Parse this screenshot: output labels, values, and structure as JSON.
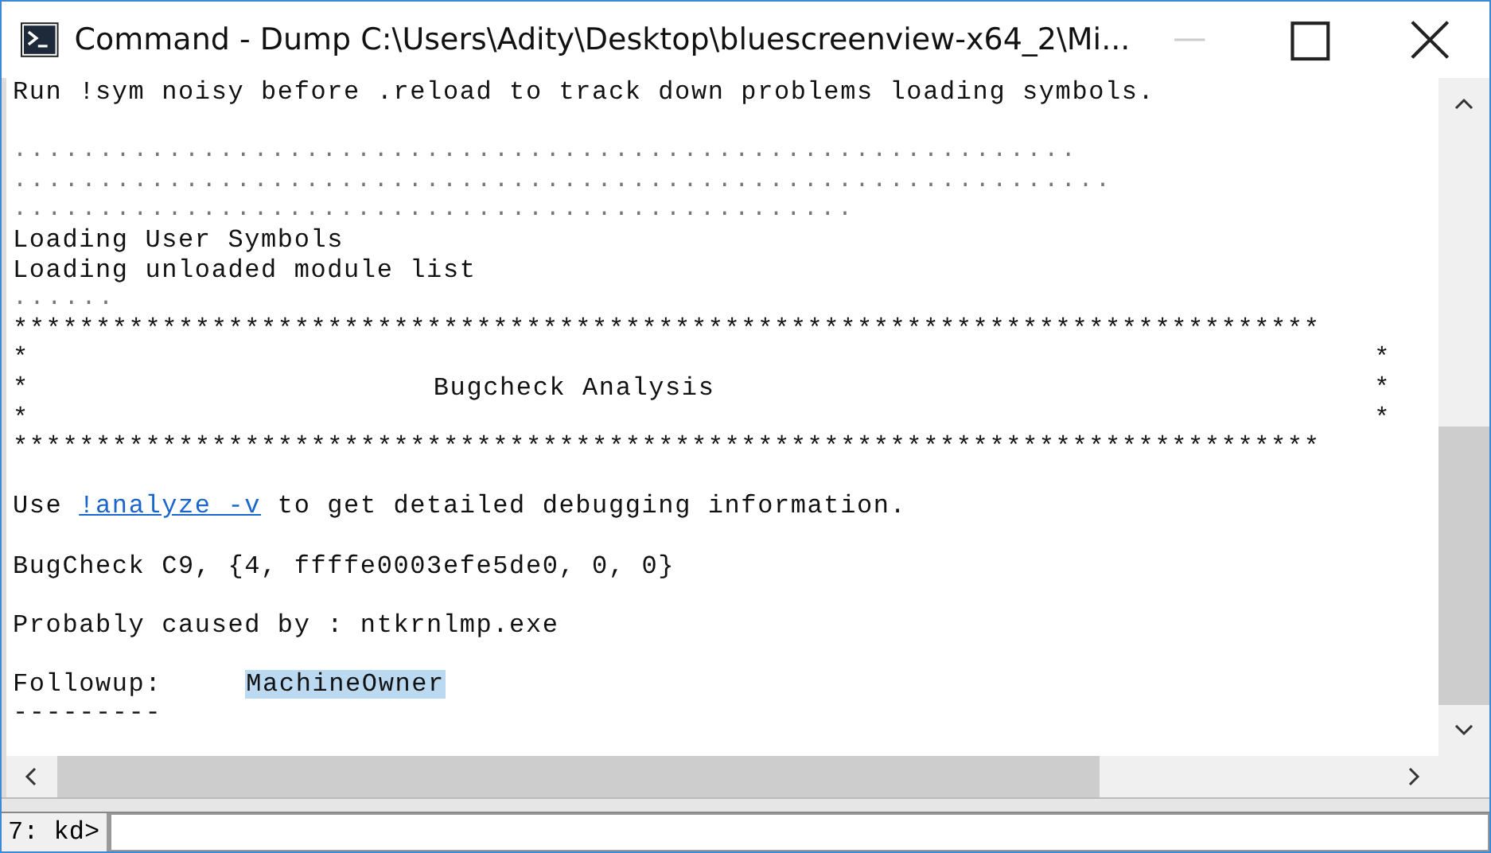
{
  "window": {
    "title": "Command - Dump C:\\Users\\Adity\\Desktop\\bluescreenview-x64_2\\Mi..."
  },
  "output": [
    {
      "kind": "text",
      "text": "Run !sym noisy before .reload to track down problems loading symbols."
    },
    {
      "kind": "gap"
    },
    {
      "kind": "dots",
      "text": ".............................................................."
    },
    {
      "kind": "dots",
      "text": "................................................................"
    },
    {
      "kind": "dots",
      "text": "................................................."
    },
    {
      "kind": "text",
      "text": "Loading User Symbols"
    },
    {
      "kind": "text",
      "text": "Loading unloaded module list"
    },
    {
      "kind": "dots",
      "text": "......"
    },
    {
      "kind": "text",
      "text": "*******************************************************************************"
    },
    {
      "kind": "frame",
      "left": "*",
      "right": "*"
    },
    {
      "kind": "frame",
      "left": "*",
      "title": "Bugcheck Analysis",
      "right": "*"
    },
    {
      "kind": "frame",
      "left": "*",
      "right": "*"
    },
    {
      "kind": "text",
      "text": "*******************************************************************************"
    },
    {
      "kind": "gap"
    },
    {
      "kind": "link",
      "before": "Use ",
      "link": "!analyze -v",
      "after": " to get detailed debugging information."
    },
    {
      "kind": "gap"
    },
    {
      "kind": "text",
      "text": "BugCheck C9, {4, ffffe0003efe5de0, 0, 0}"
    },
    {
      "kind": "gap"
    },
    {
      "kind": "text",
      "text": "Probably caused by : ntkrnlmp.exe"
    },
    {
      "kind": "gap"
    },
    {
      "kind": "field",
      "label": "Followup:     ",
      "value": "MachineOwner",
      "selected": true
    },
    {
      "kind": "text",
      "text": "---------"
    }
  ],
  "command": {
    "prompt": "7: kd>"
  }
}
